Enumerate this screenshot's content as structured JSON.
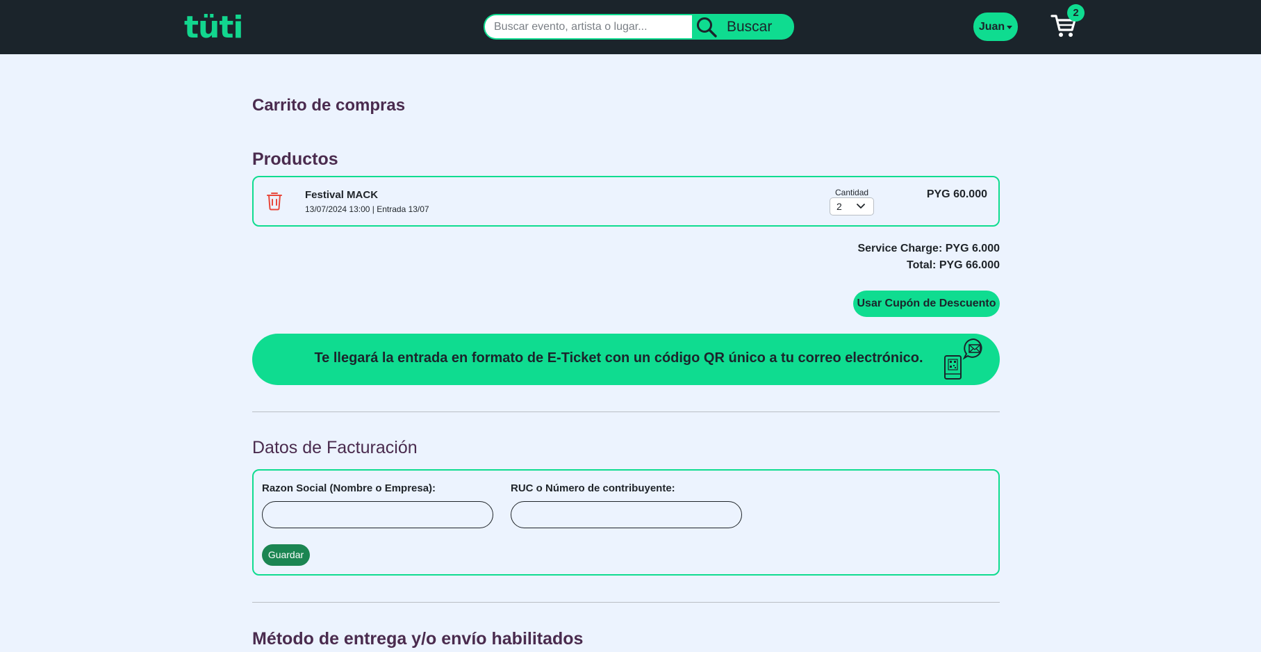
{
  "header": {
    "logo_text": "tüti",
    "search": {
      "placeholder": "Buscar evento, artista o lugar...",
      "button_label": "Buscar"
    },
    "user_label": "Juan",
    "cart_count": "2"
  },
  "page_title": "Carrito de compras",
  "products": {
    "heading": "Productos",
    "items": [
      {
        "name": "Festival MACK",
        "date": "13/07/2024 13:00 | Entrada 13/07",
        "quantity_label": "Cantidad",
        "quantity": "2",
        "price": "PYG 60.000"
      }
    ]
  },
  "summary": {
    "service_charge": "Service Charge: PYG 6.000",
    "total": "Total: PYG 66.000",
    "coupon_button": "Usar Cupón de Descuento"
  },
  "eticket_notice": "Te llegará la entrada en formato de E-Ticket con un código QR único a tu correo electrónico.",
  "billing": {
    "heading": "Datos de Facturación",
    "name_label": "Razon Social (Nombre o Empresa):",
    "name_value": "",
    "ruc_label": "RUC o Número de contribuyente:",
    "ruc_value": "",
    "save_button": "Guardar"
  },
  "delivery": {
    "heading": "Método de entrega y/o envío habilitados"
  },
  "colors": {
    "brand_green": "#0fdc90",
    "header_bg": "#1b242b",
    "page_bg": "#ecf3fe",
    "heading_purple": "#4a2b4e",
    "save_green": "#1b8552",
    "trash_red": "#e8473b"
  }
}
